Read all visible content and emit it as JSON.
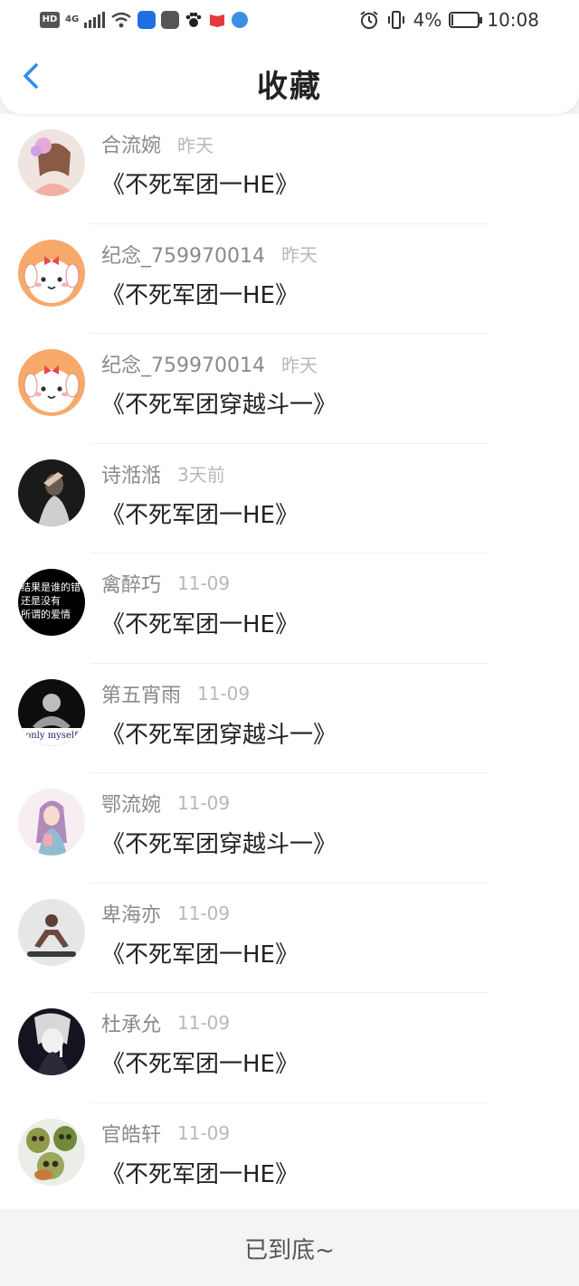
{
  "status_bar": {
    "hd": "HD",
    "net": "4G",
    "battery_text": "4%",
    "battery_level": 0.04,
    "time": "10:08"
  },
  "header": {
    "title": "收藏",
    "back_icon": "chevron-left-icon",
    "accent": "#2f8ee8"
  },
  "favorites": [
    {
      "user": "合流婉",
      "time": "昨天",
      "title": "《不死军团一HE》",
      "avatar": "girl-photo"
    },
    {
      "user": "纪念_759970014",
      "time": "昨天",
      "title": "《不死军团一HE》",
      "avatar": "cartoon-dog"
    },
    {
      "user": "纪念_759970014",
      "time": "昨天",
      "title": "《不死军团穿越斗一》",
      "avatar": "cartoon-dog"
    },
    {
      "user": "诗湉湉",
      "time": "3天前",
      "title": "《不死军团一HE》",
      "avatar": "dark-photo"
    },
    {
      "user": "禽醉巧",
      "time": "11-09",
      "title": "《不死军团一HE》",
      "avatar": "text-quote",
      "avatar_text": [
        "结果是谁的错",
        "还是没有",
        "所谓的爱情"
      ]
    },
    {
      "user": "第五宵雨",
      "time": "11-09",
      "title": "《不死军团穿越斗一》",
      "avatar": "bw-figure",
      "avatar_text": [
        "only myself"
      ]
    },
    {
      "user": "鄂流婉",
      "time": "11-09",
      "title": "《不死军团穿越斗一》",
      "avatar": "anime-girl"
    },
    {
      "user": "卑海亦",
      "time": "11-09",
      "title": "《不死军团一HE》",
      "avatar": "pushup-man"
    },
    {
      "user": "杜承允",
      "time": "11-09",
      "title": "《不死军团一HE》",
      "avatar": "bw-woman"
    },
    {
      "user": "官皓轩",
      "time": "11-09",
      "title": "《不死军团一HE》",
      "avatar": "skulls"
    }
  ],
  "footer": {
    "text": "已到底~"
  }
}
